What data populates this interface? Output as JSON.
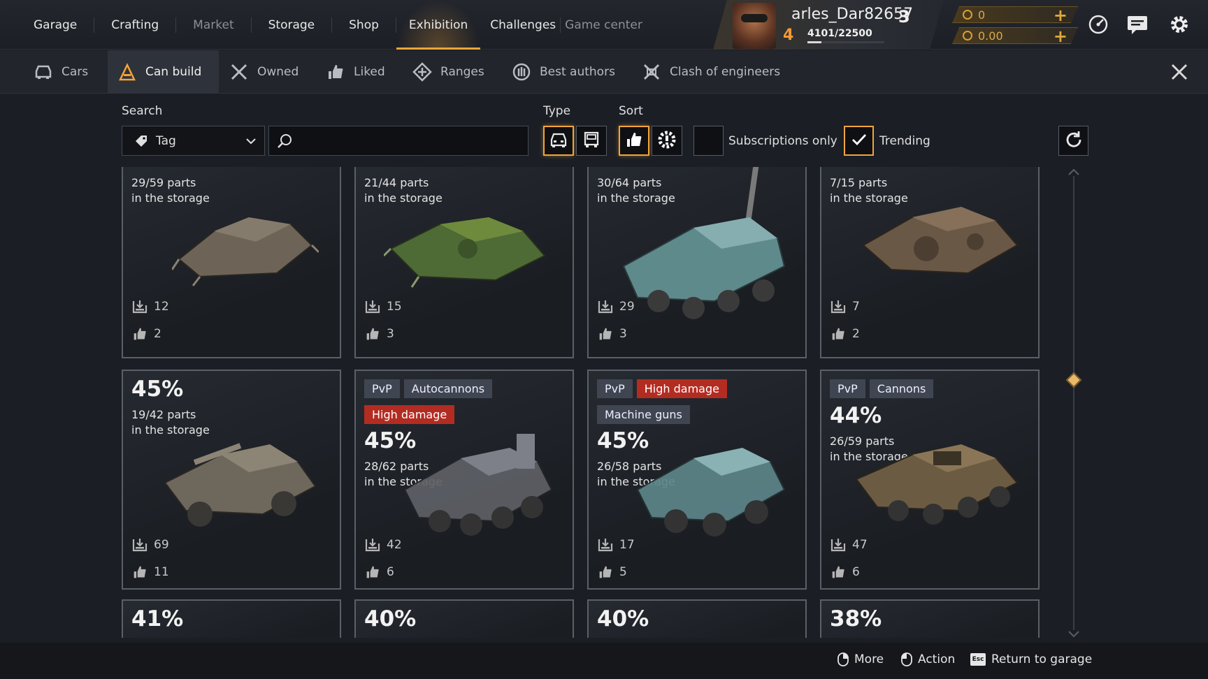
{
  "top_nav": {
    "items": [
      {
        "label": "Garage",
        "state": "normal"
      },
      {
        "label": "Crafting",
        "state": "normal"
      },
      {
        "label": "Market",
        "state": "dim"
      },
      {
        "label": "Storage",
        "state": "normal"
      },
      {
        "label": "Shop",
        "state": "normal"
      },
      {
        "label": "Exhibition",
        "state": "active"
      },
      {
        "label": "Challenges",
        "state": "normal"
      },
      {
        "label": "Game center",
        "state": "dim"
      }
    ]
  },
  "player": {
    "name": "arles_Dar82657",
    "level": "3",
    "rank": "4",
    "xp_text": "4101/22500",
    "xp_fraction": 0.18
  },
  "currency": {
    "coins": "0",
    "credits": "0.00"
  },
  "sub_tabs": [
    {
      "label": "Cars",
      "icon": "car-icon",
      "active": false
    },
    {
      "label": "Can build",
      "icon": "build-icon",
      "active": true
    },
    {
      "label": "Owned",
      "icon": "wrench-icon",
      "active": false
    },
    {
      "label": "Liked",
      "icon": "thumbs-up-icon",
      "active": false
    },
    {
      "label": "Ranges",
      "icon": "ranges-icon",
      "active": false
    },
    {
      "label": "Best authors",
      "icon": "laurel-icon",
      "active": false
    },
    {
      "label": "Clash of engineers",
      "icon": "clash-icon",
      "active": false
    }
  ],
  "filters": {
    "search_label": "Search",
    "tag_select_value": "Tag",
    "search_value": "",
    "type_label": "Type",
    "sort_label": "Sort",
    "subscriptions_label": "Subscriptions only",
    "subscriptions_checked": false,
    "trending_label": "Trending",
    "trending_checked": true
  },
  "accent_color": "#f2a43a",
  "tag_red_color": "#b32c22",
  "cards_row1": [
    {
      "parts_line1": "29/59 parts",
      "parts_line2": "in the storage",
      "downloads": "12",
      "likes": "2",
      "color": "#6d6457"
    },
    {
      "parts_line1": "21/44 parts",
      "parts_line2": "in the storage",
      "downloads": "15",
      "likes": "3",
      "color": "#4e6a35"
    },
    {
      "parts_line1": "30/64 parts",
      "parts_line2": "in the storage",
      "downloads": "29",
      "likes": "3",
      "color": "#5f8a8c"
    },
    {
      "parts_line1": "7/15 parts",
      "parts_line2": "in the storage",
      "downloads": "7",
      "likes": "2",
      "color": "#6a5846"
    }
  ],
  "cards_row2": [
    {
      "tags": [],
      "percent": "45%",
      "parts_line1": "19/42 parts",
      "parts_line2": "in the storage",
      "downloads": "69",
      "likes": "11",
      "color": "#6e675c"
    },
    {
      "tags": [
        {
          "text": "PvP",
          "red": false
        },
        {
          "text": "Autocannons",
          "red": false
        },
        {
          "text": "High damage",
          "red": true
        }
      ],
      "percent": "45%",
      "parts_line1": "28/62 parts",
      "parts_line2": "in the storage",
      "downloads": "42",
      "likes": "6",
      "color": "#5e6066"
    },
    {
      "tags": [
        {
          "text": "PvP",
          "red": false
        },
        {
          "text": "High damage",
          "red": true
        },
        {
          "text": "Machine guns",
          "red": false
        }
      ],
      "percent": "45%",
      "parts_line1": "26/58 parts",
      "parts_line2": "in the storage",
      "downloads": "17",
      "likes": "5",
      "color": "#5d8589"
    },
    {
      "tags": [
        {
          "text": "PvP",
          "red": false
        },
        {
          "text": "Cannons",
          "red": false
        }
      ],
      "percent": "44%",
      "parts_line1": "26/59 parts",
      "parts_line2": "in the storage",
      "downloads": "47",
      "likes": "6",
      "color": "#6b5b43"
    }
  ],
  "cards_row3": [
    {
      "percent": "41%"
    },
    {
      "percent": "40%"
    },
    {
      "percent": "40%"
    },
    {
      "percent": "38%"
    }
  ],
  "footer": {
    "more": "More",
    "action": "Action",
    "return": "Return to garage",
    "esc_key": "Esc"
  }
}
